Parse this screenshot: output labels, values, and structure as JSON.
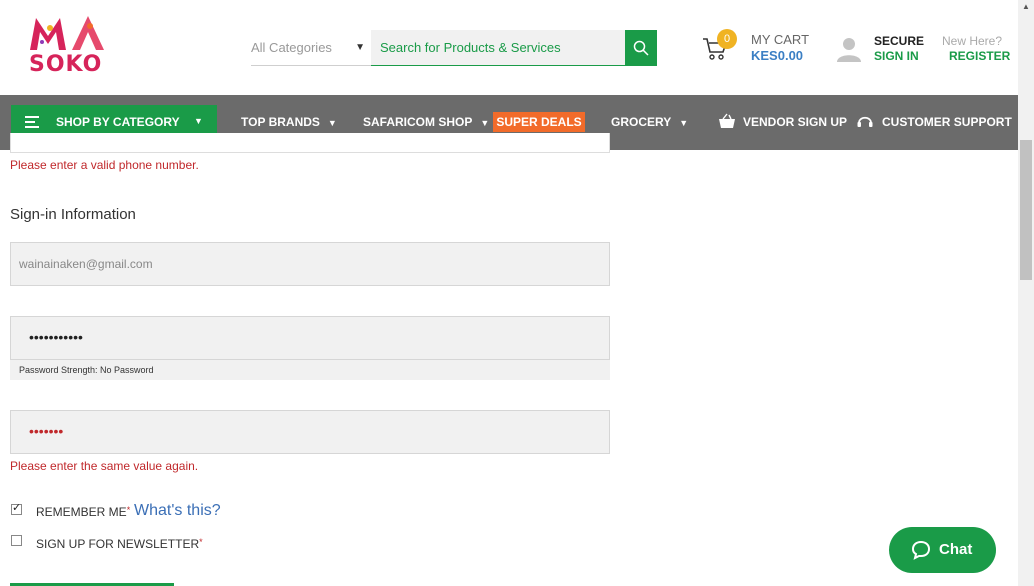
{
  "header": {
    "logo_text": "MA SOKO",
    "logo_line2": "SOKO",
    "category_select": "All Categories",
    "search_placeholder": "Search for Products & Services",
    "cart": {
      "count": "0",
      "label": "MY CART",
      "amount": "KES0.00"
    },
    "account": {
      "secure_label": "SECURE",
      "signin": "SIGN IN",
      "new_here": "New Here?",
      "register": "REGISTER"
    }
  },
  "nav": {
    "shop_by_category": "SHOP BY CATEGORY",
    "top_brands": "TOP BRANDS",
    "safaricom_shop": "SAFARICOM SHOP",
    "super_deals": "SUPER DEALS",
    "grocery": "GROCERY",
    "vendor_signup": "VENDOR SIGN UP",
    "customer_support": "CUSTOMER SUPPORT"
  },
  "form": {
    "phone_error": "Please enter a valid phone number.",
    "signin_section_title": "Sign-in Information",
    "email_value": "wainainaken@gmail.com",
    "password_mask": "•••••••••••",
    "password_strength": "Password Strength: No Password",
    "confirm_mask": "•••••••",
    "confirm_error": "Please enter the same value again.",
    "remember_me": "REMEMBER ME",
    "remember_checked": true,
    "whats_this": "What's this?",
    "newsletter": "SIGN UP FOR NEWSLETTER",
    "newsletter_checked": false,
    "required_mark": "*"
  },
  "chat": {
    "label": "Chat"
  },
  "colors": {
    "brand_green": "#1a9b48",
    "brand_pink": "#d6245a",
    "nav_gray": "#6b6b6b",
    "deals_orange": "#f26b2a",
    "error_red": "#c0282b"
  }
}
